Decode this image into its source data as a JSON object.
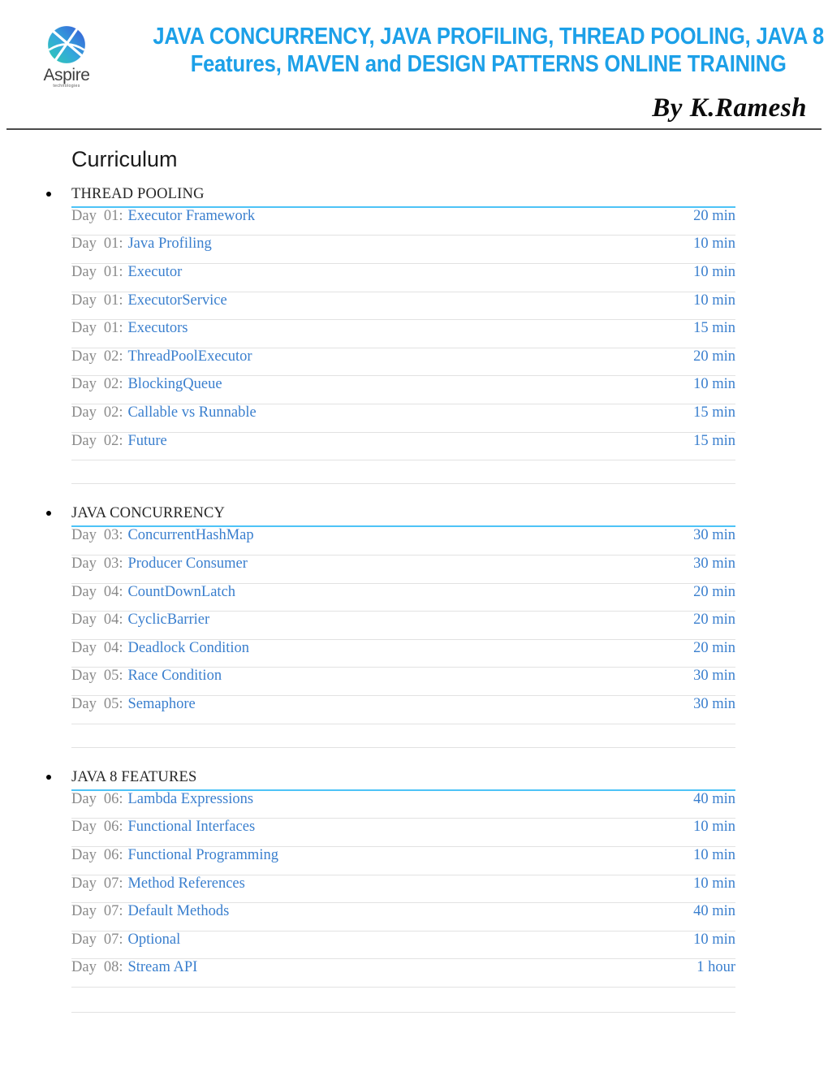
{
  "header": {
    "logo": {
      "mark_name": "aspire-globe-logo",
      "wordmark": "Aspire",
      "subword": "technologies",
      "gradient_from": "#2ECCB0",
      "gradient_to": "#3858D8"
    },
    "title_line_1": "JAVA CONCURRENCY, JAVA PROFILING, THREAD POOLING, JAVA 8",
    "title_line_2": "Features, MAVEN and DESIGN PATTERNS ONLINE TRAINING",
    "title_color": "#1CA0E8",
    "author": "By K.Ramesh"
  },
  "page": {
    "section_title": "Curriculum",
    "accent_underline": "#4DC3F7",
    "link_color": "#3A7FCE",
    "muted_color": "#8a8a8a",
    "row_rule_color": "#e2e2e2"
  },
  "modules": [
    {
      "name": "THREAD POOLING",
      "lessons": [
        {
          "day_label": "Day",
          "day_number": "01:",
          "topic": "Executor Framework",
          "duration": "20 min"
        },
        {
          "day_label": "Day",
          "day_number": "01:",
          "topic": "Java Profiling",
          "duration": "10 min"
        },
        {
          "day_label": "Day",
          "day_number": "01:",
          "topic": "Executor",
          "duration": "10 min"
        },
        {
          "day_label": "Day",
          "day_number": "01:",
          "topic": "ExecutorService",
          "duration": "10 min"
        },
        {
          "day_label": "Day",
          "day_number": "01:",
          "topic": "Executors",
          "duration": "15 min"
        },
        {
          "day_label": "Day",
          "day_number": "02:",
          "topic": "ThreadPoolExecutor",
          "duration": "20 min"
        },
        {
          "day_label": "Day",
          "day_number": "02:",
          "topic": "BlockingQueue",
          "duration": "10 min"
        },
        {
          "day_label": "Day",
          "day_number": "02:",
          "topic": "Callable vs Runnable",
          "duration": "15 min"
        },
        {
          "day_label": "Day",
          "day_number": "02:",
          "topic": "Future",
          "duration": "15 min"
        }
      ]
    },
    {
      "name": "JAVA CONCURRENCY",
      "lessons": [
        {
          "day_label": "Day",
          "day_number": "03:",
          "topic": "ConcurrentHashMap",
          "duration": "30 min"
        },
        {
          "day_label": "Day",
          "day_number": "03:",
          "topic": "Producer Consumer",
          "duration": "30 min"
        },
        {
          "day_label": "Day",
          "day_number": "04:",
          "topic": "CountDownLatch",
          "duration": "20 min"
        },
        {
          "day_label": "Day",
          "day_number": "04:",
          "topic": "CyclicBarrier",
          "duration": "20 min"
        },
        {
          "day_label": "Day",
          "day_number": "04:",
          "topic": "Deadlock Condition",
          "duration": "20 min"
        },
        {
          "day_label": "Day",
          "day_number": "05:",
          "topic": "Race Condition",
          "duration": "30 min"
        },
        {
          "day_label": "Day",
          "day_number": "05:",
          "topic": "Semaphore",
          "duration": "30 min"
        }
      ]
    },
    {
      "name": "JAVA 8 FEATURES",
      "lessons": [
        {
          "day_label": "Day",
          "day_number": "06:",
          "topic": "Lambda Expressions",
          "duration": "40 min"
        },
        {
          "day_label": "Day",
          "day_number": "06:",
          "topic": "Functional Interfaces",
          "duration": "10 min"
        },
        {
          "day_label": "Day",
          "day_number": "06:",
          "topic": "Functional Programming",
          "duration": "10 min"
        },
        {
          "day_label": "Day",
          "day_number": "07:",
          "topic": "Method References",
          "duration": "10 min"
        },
        {
          "day_label": "Day",
          "day_number": "07:",
          "topic": "Default Methods",
          "duration": "40 min"
        },
        {
          "day_label": "Day",
          "day_number": "07:",
          "topic": "Optional",
          "duration": "10 min"
        },
        {
          "day_label": "Day",
          "day_number": "08:",
          "topic": "Stream API",
          "duration": "1 hour"
        }
      ]
    }
  ]
}
